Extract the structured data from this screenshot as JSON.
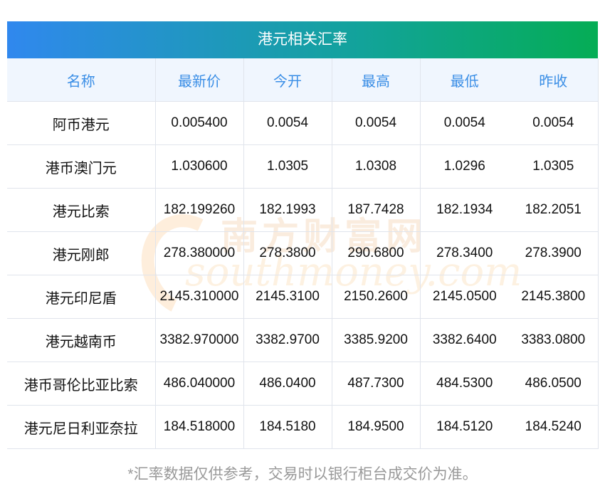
{
  "title": "港元相关汇率",
  "columns": [
    "名称",
    "最新价",
    "今开",
    "最高",
    "最低",
    "昨收"
  ],
  "rows": [
    [
      "阿币港元",
      "0.005400",
      "0.0054",
      "0.0054",
      "0.0054",
      "0.0054"
    ],
    [
      "港币澳门元",
      "1.030600",
      "1.0305",
      "1.0308",
      "1.0296",
      "1.0305"
    ],
    [
      "港元比索",
      "182.199260",
      "182.1993",
      "187.7428",
      "182.1934",
      "182.2051"
    ],
    [
      "港元刚郎",
      "278.380000",
      "278.3800",
      "290.6800",
      "278.3400",
      "278.3900"
    ],
    [
      "港元印尼盾",
      "2145.310000",
      "2145.3100",
      "2150.2600",
      "2145.0500",
      "2145.3800"
    ],
    [
      "港元越南币",
      "3382.970000",
      "3382.9700",
      "3385.9200",
      "3382.6400",
      "3383.0800"
    ],
    [
      "港币哥伦比亚比索",
      "486.040000",
      "486.0400",
      "487.7300",
      "484.5300",
      "486.0500"
    ],
    [
      "港元尼日利亚奈拉",
      "184.518000",
      "184.5180",
      "184.9500",
      "184.5120",
      "184.5240"
    ]
  ],
  "watermark": {
    "cn": "南方财富网",
    "en": "southmoney.com"
  },
  "note": "*汇率数据仅供参考，交易时以银行柜台成交价为准。"
}
